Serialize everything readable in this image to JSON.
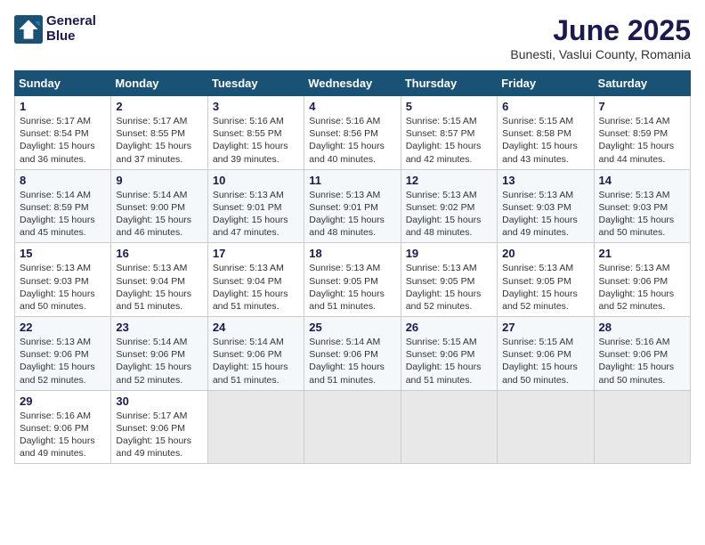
{
  "header": {
    "logo_line1": "General",
    "logo_line2": "Blue",
    "title": "June 2025",
    "subtitle": "Bunesti, Vaslui County, Romania"
  },
  "weekdays": [
    "Sunday",
    "Monday",
    "Tuesday",
    "Wednesday",
    "Thursday",
    "Friday",
    "Saturday"
  ],
  "weeks": [
    [
      {
        "day": "1",
        "info": "Sunrise: 5:17 AM\nSunset: 8:54 PM\nDaylight: 15 hours\nand 36 minutes."
      },
      {
        "day": "2",
        "info": "Sunrise: 5:17 AM\nSunset: 8:55 PM\nDaylight: 15 hours\nand 37 minutes."
      },
      {
        "day": "3",
        "info": "Sunrise: 5:16 AM\nSunset: 8:55 PM\nDaylight: 15 hours\nand 39 minutes."
      },
      {
        "day": "4",
        "info": "Sunrise: 5:16 AM\nSunset: 8:56 PM\nDaylight: 15 hours\nand 40 minutes."
      },
      {
        "day": "5",
        "info": "Sunrise: 5:15 AM\nSunset: 8:57 PM\nDaylight: 15 hours\nand 42 minutes."
      },
      {
        "day": "6",
        "info": "Sunrise: 5:15 AM\nSunset: 8:58 PM\nDaylight: 15 hours\nand 43 minutes."
      },
      {
        "day": "7",
        "info": "Sunrise: 5:14 AM\nSunset: 8:59 PM\nDaylight: 15 hours\nand 44 minutes."
      }
    ],
    [
      {
        "day": "8",
        "info": "Sunrise: 5:14 AM\nSunset: 8:59 PM\nDaylight: 15 hours\nand 45 minutes."
      },
      {
        "day": "9",
        "info": "Sunrise: 5:14 AM\nSunset: 9:00 PM\nDaylight: 15 hours\nand 46 minutes."
      },
      {
        "day": "10",
        "info": "Sunrise: 5:13 AM\nSunset: 9:01 PM\nDaylight: 15 hours\nand 47 minutes."
      },
      {
        "day": "11",
        "info": "Sunrise: 5:13 AM\nSunset: 9:01 PM\nDaylight: 15 hours\nand 48 minutes."
      },
      {
        "day": "12",
        "info": "Sunrise: 5:13 AM\nSunset: 9:02 PM\nDaylight: 15 hours\nand 48 minutes."
      },
      {
        "day": "13",
        "info": "Sunrise: 5:13 AM\nSunset: 9:03 PM\nDaylight: 15 hours\nand 49 minutes."
      },
      {
        "day": "14",
        "info": "Sunrise: 5:13 AM\nSunset: 9:03 PM\nDaylight: 15 hours\nand 50 minutes."
      }
    ],
    [
      {
        "day": "15",
        "info": "Sunrise: 5:13 AM\nSunset: 9:03 PM\nDaylight: 15 hours\nand 50 minutes."
      },
      {
        "day": "16",
        "info": "Sunrise: 5:13 AM\nSunset: 9:04 PM\nDaylight: 15 hours\nand 51 minutes."
      },
      {
        "day": "17",
        "info": "Sunrise: 5:13 AM\nSunset: 9:04 PM\nDaylight: 15 hours\nand 51 minutes."
      },
      {
        "day": "18",
        "info": "Sunrise: 5:13 AM\nSunset: 9:05 PM\nDaylight: 15 hours\nand 51 minutes."
      },
      {
        "day": "19",
        "info": "Sunrise: 5:13 AM\nSunset: 9:05 PM\nDaylight: 15 hours\nand 52 minutes."
      },
      {
        "day": "20",
        "info": "Sunrise: 5:13 AM\nSunset: 9:05 PM\nDaylight: 15 hours\nand 52 minutes."
      },
      {
        "day": "21",
        "info": "Sunrise: 5:13 AM\nSunset: 9:06 PM\nDaylight: 15 hours\nand 52 minutes."
      }
    ],
    [
      {
        "day": "22",
        "info": "Sunrise: 5:13 AM\nSunset: 9:06 PM\nDaylight: 15 hours\nand 52 minutes."
      },
      {
        "day": "23",
        "info": "Sunrise: 5:14 AM\nSunset: 9:06 PM\nDaylight: 15 hours\nand 52 minutes."
      },
      {
        "day": "24",
        "info": "Sunrise: 5:14 AM\nSunset: 9:06 PM\nDaylight: 15 hours\nand 51 minutes."
      },
      {
        "day": "25",
        "info": "Sunrise: 5:14 AM\nSunset: 9:06 PM\nDaylight: 15 hours\nand 51 minutes."
      },
      {
        "day": "26",
        "info": "Sunrise: 5:15 AM\nSunset: 9:06 PM\nDaylight: 15 hours\nand 51 minutes."
      },
      {
        "day": "27",
        "info": "Sunrise: 5:15 AM\nSunset: 9:06 PM\nDaylight: 15 hours\nand 50 minutes."
      },
      {
        "day": "28",
        "info": "Sunrise: 5:16 AM\nSunset: 9:06 PM\nDaylight: 15 hours\nand 50 minutes."
      }
    ],
    [
      {
        "day": "29",
        "info": "Sunrise: 5:16 AM\nSunset: 9:06 PM\nDaylight: 15 hours\nand 49 minutes."
      },
      {
        "day": "30",
        "info": "Sunrise: 5:17 AM\nSunset: 9:06 PM\nDaylight: 15 hours\nand 49 minutes."
      },
      {
        "day": "",
        "info": ""
      },
      {
        "day": "",
        "info": ""
      },
      {
        "day": "",
        "info": ""
      },
      {
        "day": "",
        "info": ""
      },
      {
        "day": "",
        "info": ""
      }
    ]
  ]
}
